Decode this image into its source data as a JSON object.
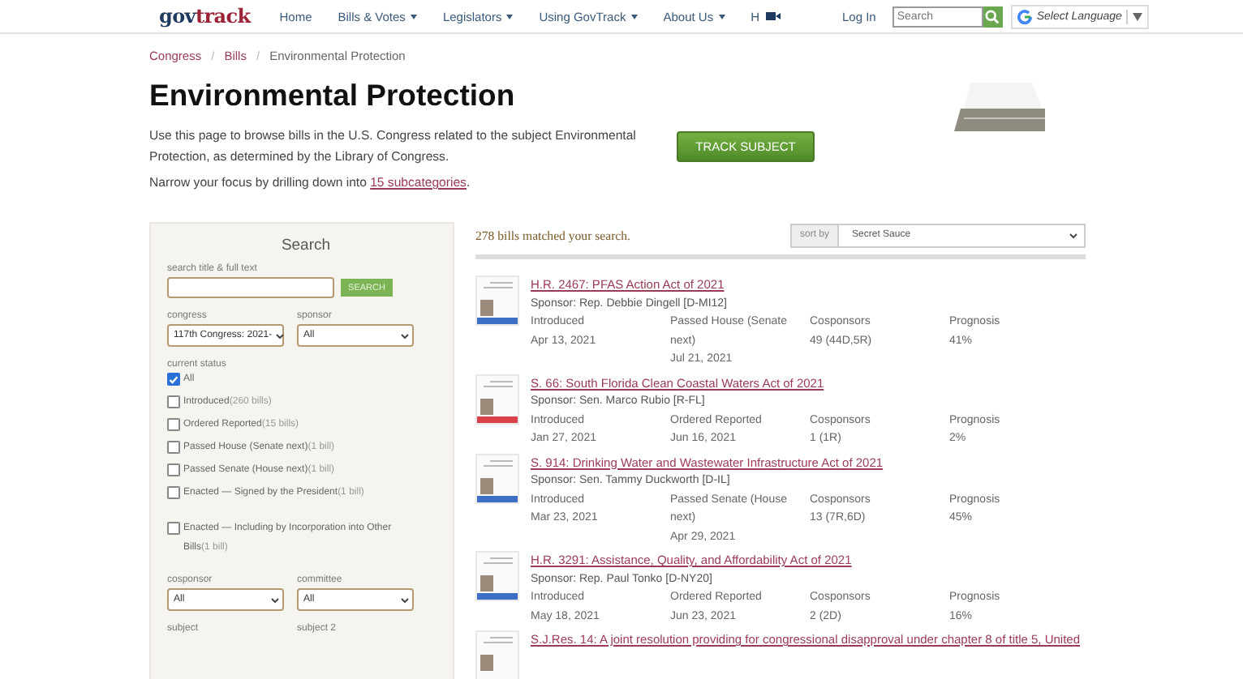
{
  "header": {
    "logo_part1": "gov",
    "logo_part2": "track",
    "nav": [
      {
        "label": "Home",
        "kind": "plain"
      },
      {
        "label": "Bills & Votes",
        "kind": "menu"
      },
      {
        "label": "Legislators",
        "kind": "menu"
      },
      {
        "label": "Using GovTrack",
        "kind": "menu"
      },
      {
        "label": "About Us",
        "kind": "menu"
      },
      {
        "label": "H",
        "kind": "video"
      }
    ],
    "login": "Log In",
    "search": {
      "placeholder": "Search"
    },
    "language": "Select Language"
  },
  "breadcrumb_separator": "/",
  "breadcrumb": [
    {
      "label": "Congress",
      "kind": "link"
    },
    {
      "label": "Bills",
      "kind": "link"
    },
    {
      "label": "Environmental Protection",
      "kind": "current"
    }
  ],
  "title": "Environmental Protection",
  "description": "Use this page to browse bills in the U.S. Congress related to the subject Environmental Protection, as determined by the Library of Congress.",
  "narrow": {
    "before": "Narrow your focus by drilling down into ",
    "link": "15 subcategories",
    "after": "."
  },
  "track_button": "TRACK SUBJECT",
  "search_panel": {
    "heading": "Search",
    "text_label": "search title & full text",
    "search_button": "SEARCH",
    "congress": {
      "label": "congress",
      "value": "117th Congress: 2021-"
    },
    "sponsor": {
      "label": "sponsor",
      "value": "All"
    },
    "status_label": "current status",
    "statuses": [
      {
        "label": "All",
        "checked": true
      },
      {
        "label": "Introduced",
        "count": "(260 bills)",
        "checked": false
      },
      {
        "label": "Ordered Reported",
        "count": "(15 bills)",
        "checked": false
      },
      {
        "label": "Passed House (Senate next)",
        "count": "(1 bill)",
        "checked": false
      },
      {
        "label": "Passed Senate (House next)",
        "count": "(1 bill)",
        "checked": false
      },
      {
        "label": "Enacted — Signed by the President",
        "count": "(1 bill)",
        "checked": false
      },
      {
        "label": "Enacted — Including by Incorporation into Other Bills",
        "count": "(1 bill)",
        "checked": false
      }
    ],
    "cosponsor": {
      "label": "cosponsor",
      "value": "All"
    },
    "committee": {
      "label": "committee",
      "value": "All"
    },
    "subject_labels": [
      "subject",
      "subject 2"
    ]
  },
  "results": {
    "count": "278 bills matched your search.",
    "sort_label": "sort by",
    "sort_value": "Secret Sauce",
    "bills": [
      {
        "title": "H.R. 2467: PFAS Action Act of 2021",
        "sponsor": "Sponsor: Rep. Debbie Dingell [D-MI12]",
        "color": "#3d6fc4",
        "columns": [
          {
            "label": "Introduced",
            "value": "Apr 13, 2021"
          },
          {
            "label": "Passed House (Senate next)",
            "value": "Jul 21, 2021"
          },
          {
            "label": "Cosponsors",
            "value": "49 (44D,5R)"
          },
          {
            "label": "Prognosis",
            "value": "41%"
          }
        ]
      },
      {
        "title": "S. 66: South Florida Clean Coastal Waters Act of 2021",
        "sponsor": "Sponsor: Sen. Marco Rubio [R-FL]",
        "color": "#d8404a",
        "columns": [
          {
            "label": "Introduced",
            "value": "Jan 27, 2021"
          },
          {
            "label": "Ordered Reported",
            "value": "Jun 16, 2021"
          },
          {
            "label": "Cosponsors",
            "value": "1 (1R)"
          },
          {
            "label": "Prognosis",
            "value": "2%"
          }
        ]
      },
      {
        "title": "S. 914: Drinking Water and Wastewater Infrastructure Act of 2021",
        "sponsor": "Sponsor: Sen. Tammy Duckworth [D-IL]",
        "color": "#3d6fc4",
        "columns": [
          {
            "label": "Introduced",
            "value": "Mar 23, 2021"
          },
          {
            "label": "Passed Senate (House next)",
            "value": "Apr 29, 2021"
          },
          {
            "label": "Cosponsors",
            "value": "13 (7R,6D)"
          },
          {
            "label": "Prognosis",
            "value": "45%"
          }
        ]
      },
      {
        "title": "H.R. 3291: Assistance, Quality, and Affordability Act of 2021",
        "sponsor": "Sponsor: Rep. Paul Tonko [D-NY20]",
        "color": "#3d6fc4",
        "columns": [
          {
            "label": "Introduced",
            "value": "May 18, 2021"
          },
          {
            "label": "Ordered Reported",
            "value": "Jun 23, 2021"
          },
          {
            "label": "Cosponsors",
            "value": "2 (2D)"
          },
          {
            "label": "Prognosis",
            "value": "16%"
          }
        ]
      },
      {
        "title": "S.J.Res. 14: A joint resolution providing for congressional disapproval under chapter 8 of title 5, United"
      }
    ]
  }
}
